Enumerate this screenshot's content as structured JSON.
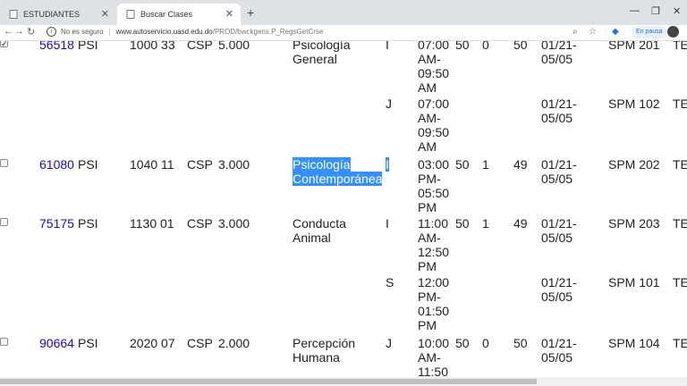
{
  "browser": {
    "tabs": [
      {
        "title": "ESTUDIANTES",
        "active": false
      },
      {
        "title": "Buscar Clases",
        "active": true
      }
    ],
    "url": {
      "security_text": "No es seguro",
      "host": "www.autoservicio.uasd.edu.do",
      "path": "/PROD/bwckgens.P_RegsGetCrse"
    },
    "pause_label": "En pausa"
  },
  "rows": [
    {
      "checked": true,
      "crn": "56518",
      "subj": "PSI",
      "crse": "1000 33",
      "campus": "CSP",
      "credits": "5.000",
      "title_lines": [
        "Psicología",
        "General"
      ],
      "title_selected": false,
      "meetings": [
        {
          "day": "I",
          "time": [
            "07:00",
            "AM-",
            "09:50",
            "AM"
          ],
          "cap": "50",
          "act": "0",
          "rem": "50",
          "date": [
            "01/21-",
            "05/05"
          ],
          "room": "SPM 201",
          "extra": "TE"
        },
        {
          "day": "J",
          "time": [
            "07:00",
            "AM-",
            "09:50",
            "AM"
          ],
          "cap": "",
          "act": "",
          "rem": "",
          "date": [
            "01/21-",
            "05/05"
          ],
          "room": "SPM 102",
          "extra": "TE"
        }
      ]
    },
    {
      "checked": false,
      "crn": "61080",
      "subj": "PSI",
      "crse": "1040 11",
      "campus": "CSP",
      "credits": "3.000",
      "title_lines": [
        "Psicología",
        "Contemporánea"
      ],
      "title_selected": true,
      "meetings": [
        {
          "day": "I",
          "time": [
            "03:00",
            "PM-",
            "05:50",
            "PM"
          ],
          "cap": "50",
          "act": "1",
          "rem": "49",
          "date": [
            "01/21-",
            "05/05"
          ],
          "room": "SPM 202",
          "extra": "TE"
        }
      ]
    },
    {
      "checked": false,
      "crn": "75175",
      "subj": "PSI",
      "crse": "1130 01",
      "campus": "CSP",
      "credits": "3.000",
      "title_lines": [
        "Conducta",
        "Animal"
      ],
      "title_selected": false,
      "meetings": [
        {
          "day": "I",
          "time": [
            "11:00",
            "AM-",
            "12:50",
            "PM"
          ],
          "cap": "50",
          "act": "1",
          "rem": "49",
          "date": [
            "01/21-",
            "05/05"
          ],
          "room": "SPM 203",
          "extra": "TE"
        },
        {
          "day": "S",
          "time": [
            "12:00",
            "PM-",
            "01:50",
            "PM"
          ],
          "cap": "",
          "act": "",
          "rem": "",
          "date": [
            "01/21-",
            "05/05"
          ],
          "room": "SPM 101",
          "extra": "TE"
        }
      ]
    },
    {
      "checked": false,
      "crn": "90664",
      "subj": "PSI",
      "crse": "2020 07",
      "campus": "CSP",
      "credits": "2.000",
      "title_lines": [
        "Percepción",
        "Humana"
      ],
      "title_selected": false,
      "meetings": [
        {
          "day": "J",
          "time": [
            "10:00",
            "AM-",
            "11:50",
            ""
          ],
          "cap": "50",
          "act": "0",
          "rem": "50",
          "date": [
            "01/21-",
            "05/05"
          ],
          "room": "SPM 104",
          "extra": "TE"
        }
      ]
    }
  ]
}
